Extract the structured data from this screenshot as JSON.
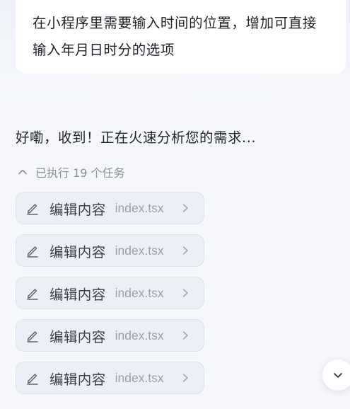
{
  "user_message": {
    "line1": "在小程序里需要输入时间的位置，增加可直接",
    "line2": "输入年月日时分的选项"
  },
  "assistant": {
    "reply": "好嘞，收到！正在火速分析您的需求..."
  },
  "tasks": {
    "summary": "已执行 19 个任务",
    "toggle_icon": "chevron-up-icon",
    "items": [
      {
        "action": "编辑内容",
        "file": "index.tsx",
        "icon": "pencil-icon"
      },
      {
        "action": "编辑内容",
        "file": "index.tsx",
        "icon": "pencil-icon"
      },
      {
        "action": "编辑内容",
        "file": "index.tsx",
        "icon": "pencil-icon"
      },
      {
        "action": "编辑内容",
        "file": "index.tsx",
        "icon": "pencil-icon"
      },
      {
        "action": "编辑内容",
        "file": "index.tsx",
        "icon": "pencil-icon"
      }
    ]
  },
  "scroll_button": {
    "icon": "chevron-down-icon"
  },
  "colors": {
    "background": "#f4f6fa",
    "bubble": "#ffffff",
    "card": "#eceff6",
    "card_border": "#dde2ec",
    "text_primary": "#1f2329",
    "text_muted": "#8a8f99"
  }
}
